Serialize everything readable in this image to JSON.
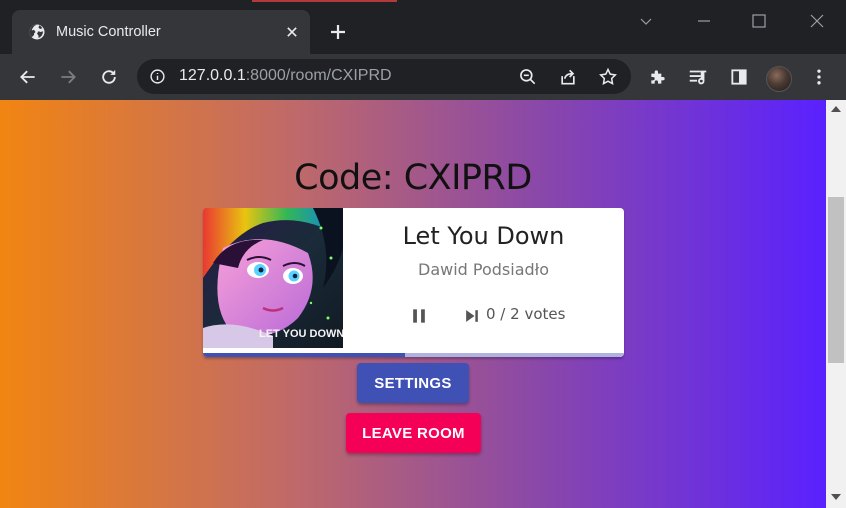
{
  "browser": {
    "tab_title": "Music Controller",
    "url_host": "127.0.0.1",
    "url_path": ":8000/room/CXIPRD"
  },
  "icons": {
    "favicon": "globe-icon",
    "tab_close": "close-icon",
    "new_tab": "plus-icon",
    "back": "arrow-left-icon",
    "forward": "arrow-right-icon",
    "reload": "reload-icon",
    "site_info": "info-icon",
    "zoom": "zoom-out-icon",
    "share": "share-icon",
    "bookmark": "star-icon",
    "extensions": "puzzle-icon",
    "media": "queue-music-icon",
    "side_panel": "side-panel-icon",
    "menu": "kebab-menu-icon",
    "pause": "pause-icon",
    "skip": "skip-next-icon"
  },
  "room": {
    "code_label": "Code: CXIPRD"
  },
  "player": {
    "title": "Let You Down",
    "artist": "Dawid Podsiadło",
    "album_caption": "LET YOU DOWN",
    "votes_text": "0 / 2 votes",
    "progress_fraction": 0.48
  },
  "buttons": {
    "settings": "SETTINGS",
    "leave": "LEAVE ROOM"
  },
  "colors": {
    "primary": "#3f51b5",
    "secondary": "#f50057",
    "gradient_start": "#f18512",
    "gradient_end": "#5a21ff"
  }
}
